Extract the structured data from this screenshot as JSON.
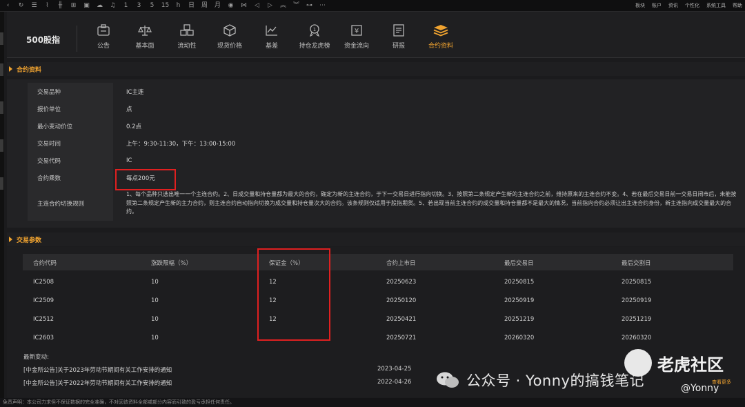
{
  "toolbar": {
    "icons": [
      "back-icon",
      "refresh-icon",
      "list-icon",
      "line-chart-icon",
      "candlestick-icon",
      "chart-settings-icon",
      "screen-icon",
      "cloud-icon",
      "bell-icon"
    ],
    "periods": [
      "1",
      "3",
      "5",
      "15",
      "h",
      "日",
      "周",
      "月"
    ],
    "right_menu": [
      "板块",
      "账户",
      "资讯",
      "个性化",
      "系统工具",
      "帮助"
    ]
  },
  "nav": {
    "brand": "500股指",
    "tabs": [
      {
        "label": "公告",
        "icon": "announcement-icon"
      },
      {
        "label": "基本面",
        "icon": "scale-icon"
      },
      {
        "label": "流动性",
        "icon": "cubes-icon"
      },
      {
        "label": "现货价格",
        "icon": "box-icon"
      },
      {
        "label": "基差",
        "icon": "wave-chart-icon"
      },
      {
        "label": "持仓龙虎榜",
        "icon": "medal-icon"
      },
      {
        "label": "资金流向",
        "icon": "money-icon"
      },
      {
        "label": "研报",
        "icon": "report-icon"
      },
      {
        "label": "合约资料",
        "icon": "layers-icon",
        "active": true
      }
    ]
  },
  "contract_info": {
    "title": "合约资料",
    "rows": [
      {
        "key": "交易品种",
        "value": "IC主连"
      },
      {
        "key": "报价单位",
        "value": "点"
      },
      {
        "key": "最小变动价位",
        "value": "0.2点"
      },
      {
        "key": "交易时间",
        "value": "上午：9:30-11:30，下午：13:00-15:00"
      },
      {
        "key": "交易代码",
        "value": "IC"
      },
      {
        "key": "合约乘数",
        "value": "每点200元"
      },
      {
        "key": "主连合约切换规则",
        "value": "1、每个品种只选出唯一一个主连合约。2、日成交量和持仓量都为最大的合约，确定为新的主连合约，于下一交易日进行指向切换。3、按照第二条规定产生新的主连合约之前，维持原来的主连合约不变。4、若在最后交易日前一交易日闭市后，未能按照第二条规定产生新的主力合约，则主连合约自动指向切换为成交量和持仓量次大的合约。该条规则仅适用于股指期货。5、若出现当前主连合约的成交量和持仓量都不是最大的情况，当前指向合约必须让出主连合约身份，新主连指向成交量最大的合约。"
      }
    ]
  },
  "trading_params": {
    "title": "交易参数",
    "columns": [
      "合约代码",
      "涨跌限幅（%）",
      "保证金（%）",
      "合约上市日",
      "最后交易日",
      "最后交割日"
    ],
    "rows": [
      [
        "IC2508",
        "10",
        "12",
        "20250623",
        "20250815",
        "20250815"
      ],
      [
        "IC2509",
        "10",
        "12",
        "20250120",
        "20250919",
        "20250919"
      ],
      [
        "IC2512",
        "10",
        "12",
        "20250421",
        "20251219",
        "20251219"
      ],
      [
        "IC2603",
        "10",
        "",
        "20250721",
        "20260320",
        "20260320"
      ]
    ],
    "changes_title": "最新变动:",
    "changes": [
      {
        "text": "[中金所公告]关于2023年劳动节期间有关工作安排的通知",
        "date": "2023-04-25"
      },
      {
        "text": "[中金所公告]关于2022年劳动节期间有关工作安排的通知",
        "date": "2022-04-26"
      }
    ],
    "more": "查看更多"
  },
  "footer": "免责声明：本公司力求但不保证数据的完全准确，不对因该资料全部或部分内容而引致的盈亏承担任何责任。",
  "watermark": {
    "wechat": "公众号 · Yonny的搞钱笔记",
    "brand": "老虎社区",
    "handle": "@Yonny"
  },
  "colors": {
    "accent": "#f0a330",
    "highlight": "#e02020",
    "background": "#1b1b1d"
  }
}
